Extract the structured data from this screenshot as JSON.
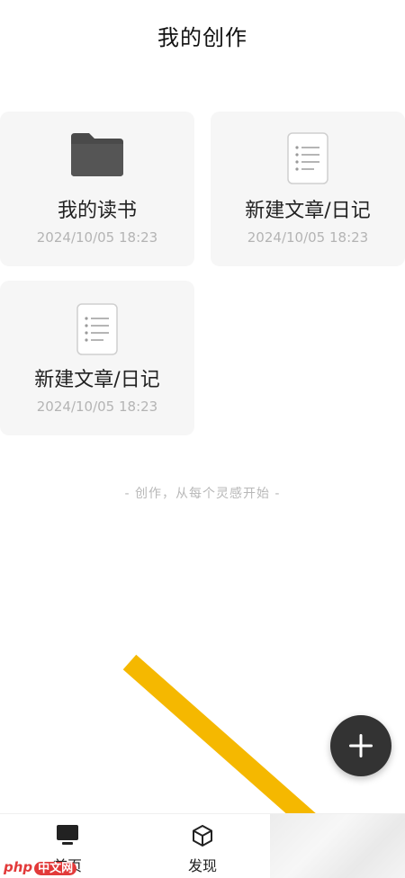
{
  "header": {
    "title": "我的创作"
  },
  "cards": [
    {
      "name": "我的读书",
      "date": "2024/10/05 18:23",
      "icon": "folder-icon"
    },
    {
      "name": "新建文章/日记",
      "date": "2024/10/05 18:23",
      "icon": "document-icon"
    },
    {
      "name": "新建文章/日记",
      "date": "2024/10/05 18:23",
      "icon": "document-icon"
    }
  ],
  "slogan": "- 创作，从每个灵感开始 -",
  "fab": {
    "icon": "plus-icon"
  },
  "tabs": [
    {
      "label": "首页",
      "icon": "monitor-icon"
    },
    {
      "label": "发现",
      "icon": "cube-icon"
    }
  ],
  "watermark": {
    "text": "php",
    "cn": "中文网"
  },
  "colors": {
    "arrow": "#f5b800",
    "fab": "#333333",
    "card_bg": "#f6f6f6",
    "date": "#b4b4b4"
  }
}
